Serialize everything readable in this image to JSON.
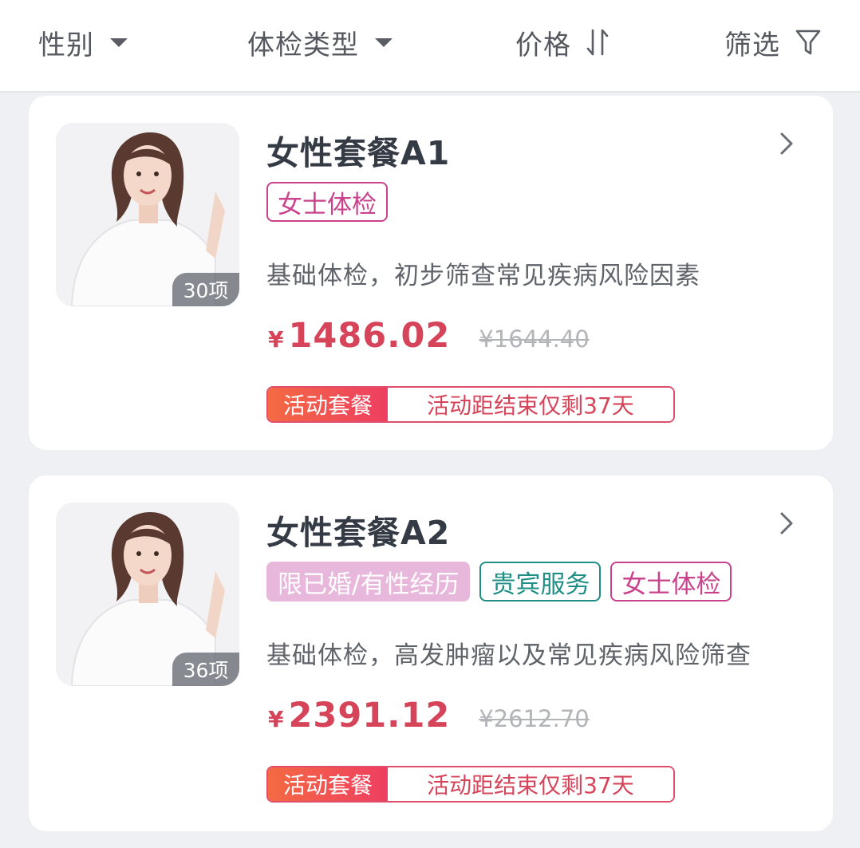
{
  "filters": [
    {
      "label": "性别",
      "icon": "caret-down-icon"
    },
    {
      "label": "体检类型",
      "icon": "caret-down-icon"
    },
    {
      "label": "价格",
      "icon": "sort-icon"
    },
    {
      "label": "筛选",
      "icon": "funnel-icon"
    }
  ],
  "packages": [
    {
      "title": "女性套餐A1",
      "item_count": "30项",
      "tags": [
        {
          "label": "女士体检",
          "style": "pink"
        }
      ],
      "description": "基础体检，初步筛查常见疾病风险因素",
      "currency": "¥",
      "price": "1486.02",
      "original_price": "¥1644.40",
      "promo_label": "活动套餐",
      "promo_text": "活动距结束仅剩37天"
    },
    {
      "title": "女性套餐A2",
      "item_count": "36项",
      "tags": [
        {
          "label": "限已婚/有性经历",
          "style": "filled"
        },
        {
          "label": "贵宾服务",
          "style": "teal"
        },
        {
          "label": "女士体检",
          "style": "pink"
        }
      ],
      "description": "基础体检，高发肿瘤以及常见疾病风险筛查",
      "currency": "¥",
      "price": "2391.12",
      "original_price": "¥2612.70",
      "promo_label": "活动套餐",
      "promo_text": "活动距结束仅剩37天"
    }
  ],
  "colors": {
    "price": "#d6445a",
    "tag_pink": "#c9428b",
    "tag_teal": "#1f8f86",
    "tag_filled_bg": "#e8b7dc",
    "promo_gradient_start": "#f46a42",
    "promo_gradient_end": "#ee3e62",
    "page_bg": "#eef0f4"
  }
}
